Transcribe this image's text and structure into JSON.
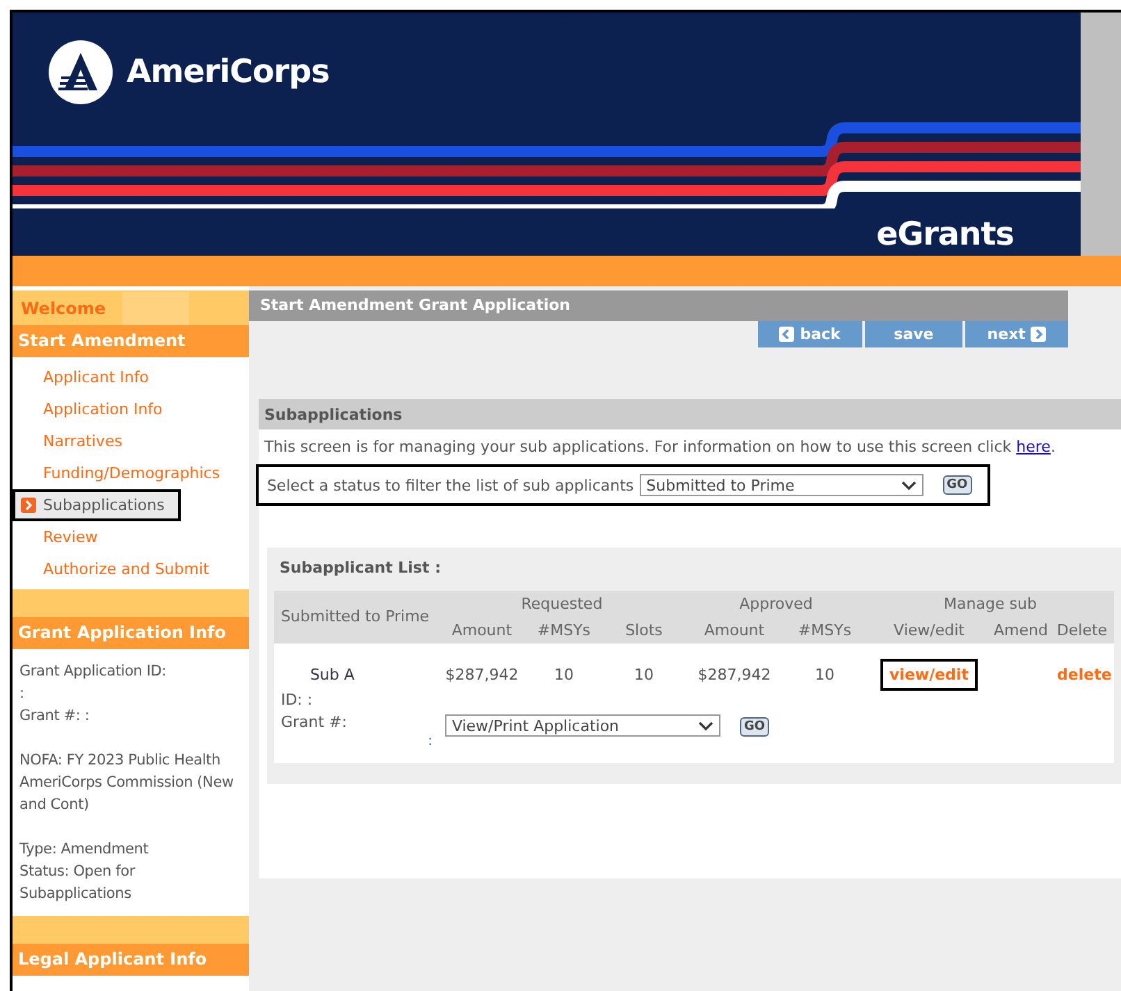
{
  "header": {
    "logo": "AmeriCorps",
    "app": "eGrants"
  },
  "sidebar": {
    "welcome": "Welcome",
    "sections": [
      {
        "title": "Start Amendment",
        "kind": "nav",
        "items": [
          {
            "label": "Applicant Info",
            "selected": false,
            "highlighted": false
          },
          {
            "label": "Application Info",
            "selected": false,
            "highlighted": false
          },
          {
            "label": "Narratives",
            "selected": false,
            "highlighted": false
          },
          {
            "label": "Funding/Demographics",
            "selected": false,
            "highlighted": false
          },
          {
            "label": "Subapplications",
            "selected": true,
            "highlighted": true
          },
          {
            "label": "Review",
            "selected": false,
            "highlighted": false
          },
          {
            "label": "Authorize and Submit",
            "selected": false,
            "highlighted": false
          }
        ]
      },
      {
        "title": "Grant Application Info",
        "kind": "info",
        "paragraphs": [
          [
            "Grant Application ID:",
            ":",
            "Grant #: :"
          ],
          [
            "NOFA: FY 2023 Public Health AmeriCorps Commission (New and Cont)"
          ],
          [
            "Type: Amendment",
            "Status: Open for Subapplications"
          ]
        ]
      },
      {
        "title": "Legal Applicant Info",
        "kind": "info"
      }
    ]
  },
  "main": {
    "title": "Start Amendment Grant Application",
    "nav_buttons": [
      {
        "label": "back",
        "kind": "previous"
      },
      {
        "label": "save",
        "kind": "plain"
      },
      {
        "label": "next",
        "kind": "forward"
      }
    ],
    "section": {
      "title": "Subapplications",
      "intro": {
        "text": "This screen is for managing your sub applications. For information on how to use this screen click ",
        "link": "here",
        "end": "."
      },
      "filter": {
        "label": "Select a status to filter the list of sub applicants",
        "value": "Submitted to Prime",
        "button": "GO",
        "highlighted": true
      },
      "list": {
        "title": "Subapplicant List :",
        "first_header": "Submitted to Prime",
        "groups": [
          {
            "label": "Requested",
            "columns": [
              "Amount",
              "#MSYs",
              "Slots"
            ]
          },
          {
            "label": "Approved",
            "columns": [
              "Amount",
              "#MSYs"
            ]
          },
          {
            "label": "Manage sub",
            "columns": [
              "View/edit",
              "Amend",
              "Delete"
            ]
          }
        ],
        "rows": [
          {
            "name": "Sub A",
            "cells": [
              "$287,942",
              "10",
              "10",
              "$287,942",
              "10"
            ],
            "view": {
              "label": "view/edit",
              "highlighted": true
            },
            "delete": "delete",
            "id": "ID: :",
            "grant": "Grant #:",
            "grant_value": ":",
            "action": {
              "value": "View/Print Application",
              "button": "GO"
            }
          }
        ]
      }
    }
  }
}
